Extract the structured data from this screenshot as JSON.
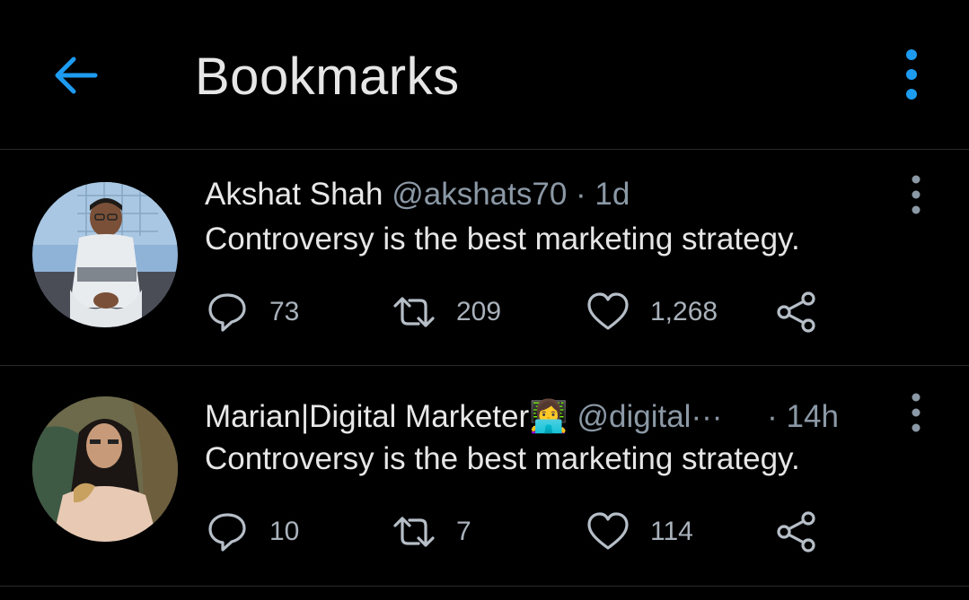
{
  "header": {
    "title": "Bookmarks",
    "back_icon": "arrow-left-icon",
    "more_icon": "more-vertical-icon",
    "accent_color": "#1d9bf0"
  },
  "tweets": [
    {
      "name": "Akshat Shah",
      "handle": "@akshats70",
      "separator": "·",
      "time": "1d",
      "text": "Controversy is the best marketing strategy.",
      "replies": "73",
      "retweets": "209",
      "likes": "1,268",
      "avatar": "avatar-photo"
    },
    {
      "name": "Marian|Digital Marketer👩‍💻",
      "handle": "@digital···",
      "separator": "·",
      "time": "14h",
      "text": "Controversy is the best marketing strategy.",
      "replies": "10",
      "retweets": "7",
      "likes": "114",
      "avatar": "avatar-photo"
    }
  ]
}
